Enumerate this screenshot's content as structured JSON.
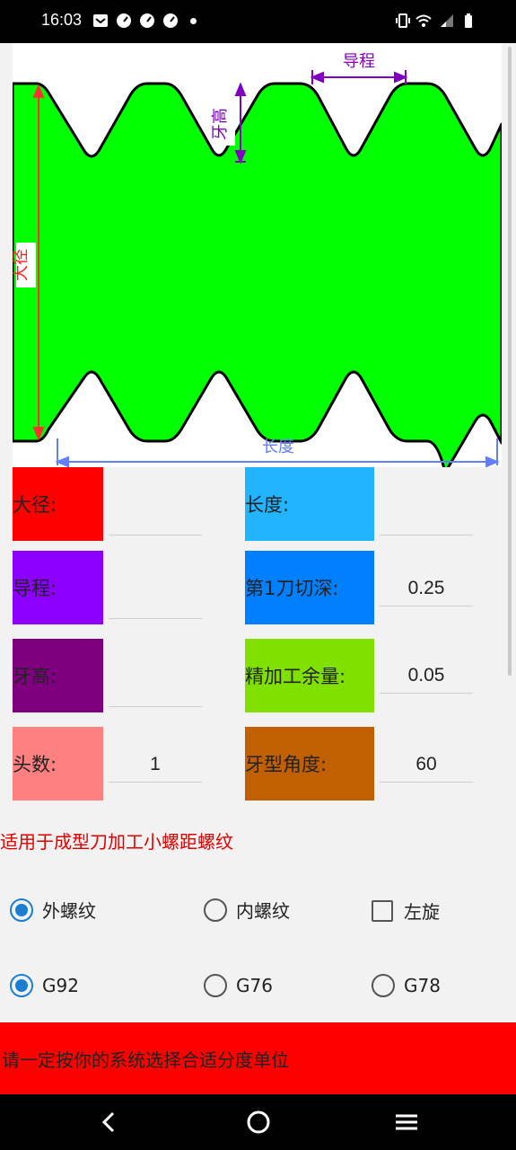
{
  "status": {
    "time": "16:03"
  },
  "fields": {
    "major_diameter": {
      "label": "大径:",
      "value": "",
      "color": "#ff0000"
    },
    "length": {
      "label": "长度:",
      "value": "",
      "color": "#22b4ff"
    },
    "lead": {
      "label": "导程:",
      "value": "",
      "color": "#8b00ff"
    },
    "first_cut_depth": {
      "label": "第1刀切深:",
      "value": "0.25",
      "color": "#0080ff"
    },
    "thread_height": {
      "label": "牙高:",
      "value": "",
      "color": "#7f007f"
    },
    "finish_allowance": {
      "label": "精加工余量:",
      "value": "0.05",
      "color": "#80e000"
    },
    "starts": {
      "label": "头数:",
      "value": "1",
      "color": "#ff8080"
    },
    "thread_angle": {
      "label": "牙型角度:",
      "value": "60",
      "color": "#c06000"
    }
  },
  "diagram": {
    "lead_label": "导程",
    "height_label": "牙高",
    "diameter_label": "大径",
    "length_label": "长度",
    "fill_color": "#00ff00"
  },
  "note": "适用于成型刀加工小螺距螺纹",
  "options": {
    "external": {
      "label": "外螺纹",
      "checked": true
    },
    "internal": {
      "label": "内螺纹",
      "checked": false
    },
    "left_hand": {
      "label": "左旋",
      "checked": false
    },
    "g92": {
      "label": "G92",
      "checked": true
    },
    "g76": {
      "label": "G76",
      "checked": false
    },
    "g78": {
      "label": "G78",
      "checked": false
    }
  },
  "warning": "请一定按你的系统选择合适分度单位",
  "icons": [
    "mail-icon",
    "speed-icon",
    "vibrate-icon",
    "wifi-icon",
    "signal-icon",
    "battery-icon",
    "back-icon",
    "home-icon",
    "menu-icon"
  ]
}
